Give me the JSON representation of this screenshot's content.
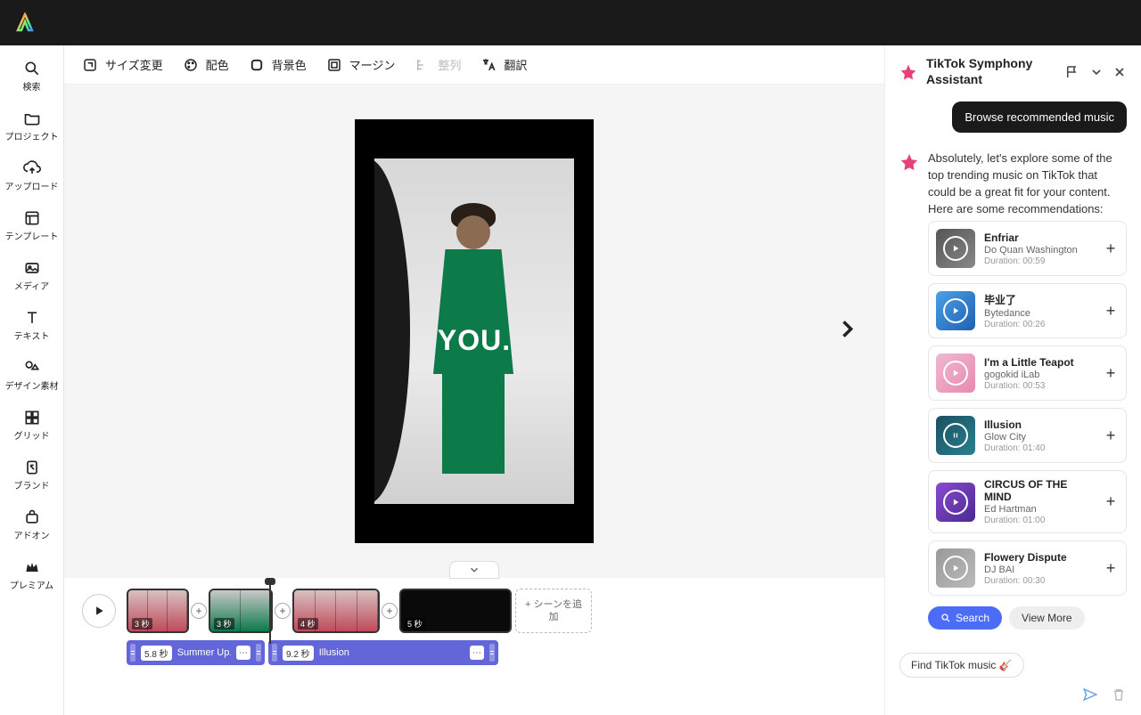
{
  "sidebar": {
    "items": [
      {
        "label": "検索"
      },
      {
        "label": "プロジェクト"
      },
      {
        "label": "アップロード"
      },
      {
        "label": "テンプレート"
      },
      {
        "label": "メディア"
      },
      {
        "label": "テキスト"
      },
      {
        "label": "デザイン素材"
      },
      {
        "label": "グリッド"
      },
      {
        "label": "ブランド"
      },
      {
        "label": "アドオン"
      },
      {
        "label": "プレミアム"
      }
    ]
  },
  "toolbar": {
    "resize": "サイズ変更",
    "colors": "配色",
    "bg": "背景色",
    "margin": "マージン",
    "align": "整列",
    "translate": "翻訳"
  },
  "canvas": {
    "overlay_text": "YOU."
  },
  "timeline": {
    "clips": [
      {
        "duration": "3 秒"
      },
      {
        "duration": "3 秒"
      },
      {
        "duration": "4 秒"
      },
      {
        "duration": "5 秒"
      }
    ],
    "add_scene": "+ シーンを追加",
    "audio": [
      {
        "duration": "5.8 秒",
        "name": "Summer Up..."
      },
      {
        "duration": "9.2 秒",
        "name": "Illusion"
      }
    ]
  },
  "panel": {
    "title": "TikTok Symphony Assistant",
    "user_msg": "Browse recommended music",
    "asst_msg": "Absolutely, let's explore some of the top trending music on TikTok that could be a great fit for your content. Here are some recommendations:",
    "music": [
      {
        "title": "Enfriar",
        "artist": "Do Quan Washington",
        "duration": "Duration: 00:59",
        "thumb_bg": "linear-gradient(135deg,#555 0%,#888 100%)"
      },
      {
        "title": "毕业了",
        "artist": "Bytedance",
        "duration": "Duration: 00:26",
        "thumb_bg": "linear-gradient(135deg,#4aa0e8 0%,#2060b0 100%)"
      },
      {
        "title": "I'm a Little Teapot",
        "artist": "gogokid iLab",
        "duration": "Duration: 00:53",
        "thumb_bg": "linear-gradient(135deg,#f0b8d0 0%,#e88ab0 100%)"
      },
      {
        "title": "Illusion",
        "artist": "Glow City",
        "duration": "Duration: 01:40",
        "thumb_bg": "linear-gradient(135deg,#1a5060 0%,#2a8090 100%)",
        "playing": true
      },
      {
        "title": "CIRCUS OF THE MIND",
        "artist": "Ed Hartman",
        "duration": "Duration: 01:00",
        "thumb_bg": "linear-gradient(135deg,#8a4ad0 0%,#4a2a90 100%)"
      },
      {
        "title": "Flowery Dispute",
        "artist": "DJ BAI",
        "duration": "Duration: 00:30",
        "thumb_bg": "linear-gradient(135deg,#999 0%,#bbb 100%)"
      }
    ],
    "search_btn": "Search",
    "more_btn": "View More",
    "suggestion": "Find TikTok music 🎸"
  }
}
